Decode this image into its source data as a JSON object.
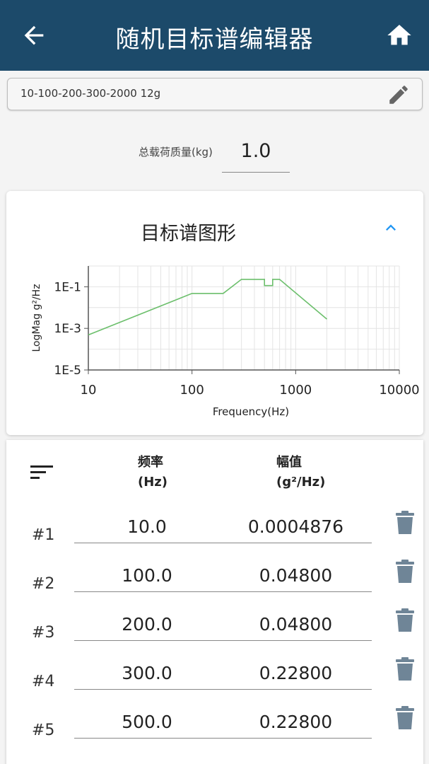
{
  "appbar": {
    "title": "随机目标谱编辑器",
    "back_icon": "arrow-left-icon",
    "home_icon": "home-icon"
  },
  "profile": {
    "name": "10-100-200-300-2000 12g",
    "edit_icon": "pencil-icon"
  },
  "mass": {
    "label": "总载荷质量(kg)",
    "value": "1.0"
  },
  "chart_card": {
    "title": "目标谱图形",
    "toggle_icon": "chevron-up-icon"
  },
  "chart_data": {
    "type": "line",
    "x_scale": "log",
    "y_scale": "log",
    "xlabel": "Frequency(Hz)",
    "ylabel": "LogMag g²/Hz",
    "xlim": [
      10,
      10000
    ],
    "ylim": [
      1e-05,
      1
    ],
    "x_ticks": [
      "10",
      "100",
      "1000",
      "10000"
    ],
    "y_ticks": [
      "1E-1",
      "1E-3",
      "1E-5"
    ],
    "grid": true,
    "line_color": "#6cbf6c",
    "x": [
      10,
      100,
      200,
      300,
      500,
      500,
      600,
      600,
      700,
      2000
    ],
    "y": [
      0.0004876,
      0.048,
      0.048,
      0.228,
      0.228,
      0.114,
      0.114,
      0.228,
      0.228,
      0.0028
    ]
  },
  "table": {
    "sort_icon": "sort-icon",
    "freq_header": [
      "频率",
      "(Hz)"
    ],
    "amp_header": [
      "幅值",
      "(g²/Hz)"
    ],
    "delete_icon": "trash-icon",
    "rows": [
      {
        "index": "#1",
        "freq": "10.0",
        "amp": "0.0004876"
      },
      {
        "index": "#2",
        "freq": "100.0",
        "amp": "0.04800"
      },
      {
        "index": "#3",
        "freq": "200.0",
        "amp": "0.04800"
      },
      {
        "index": "#4",
        "freq": "300.0",
        "amp": "0.22800"
      },
      {
        "index": "#5",
        "freq": "500.0",
        "amp": "0.22800"
      }
    ]
  },
  "colors": {
    "appbar": "#1c4a6a",
    "accent": "#2196f3",
    "icon_gray": "#5f6b75",
    "trash": "#6f8597"
  }
}
